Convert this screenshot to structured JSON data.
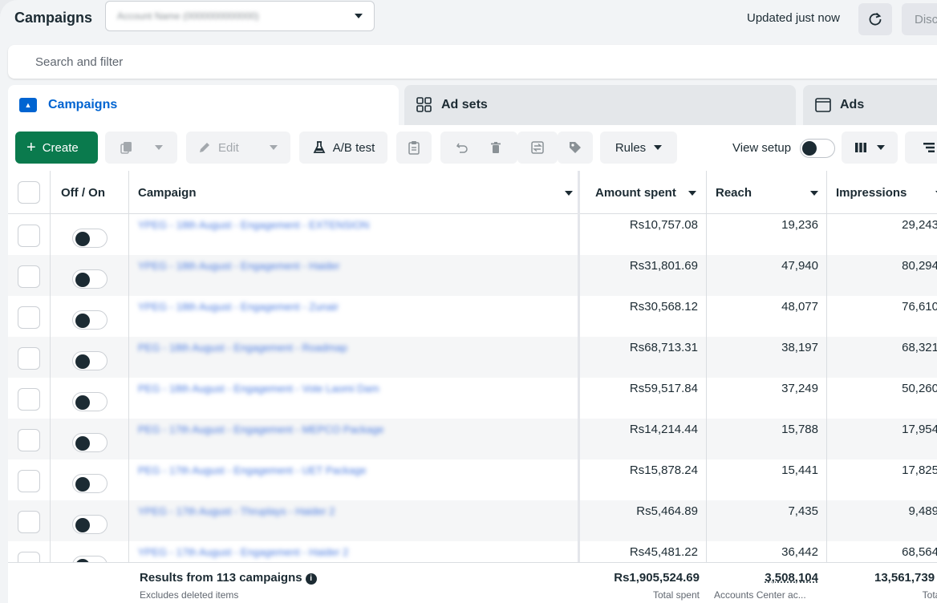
{
  "header": {
    "title": "Campaigns",
    "updated_text": "Updated just now",
    "discard_label": "Discard"
  },
  "search": {
    "placeholder": "Search and filter"
  },
  "tabs": [
    {
      "label": "Campaigns"
    },
    {
      "label": "Ad sets"
    },
    {
      "label": "Ads"
    }
  ],
  "toolbar": {
    "create_label": "Create",
    "edit_label": "Edit",
    "ab_test_label": "A/B test",
    "rules_label": "Rules",
    "view_setup_label": "View setup"
  },
  "table": {
    "columns": {
      "off_on": "Off / On",
      "campaign": "Campaign",
      "amount_spent": "Amount spent",
      "reach": "Reach",
      "impressions": "Impressions"
    },
    "rows": [
      {
        "amount": "Rs10,757.08",
        "reach": "19,236",
        "impressions": "29,243"
      },
      {
        "amount": "Rs31,801.69",
        "reach": "47,940",
        "impressions": "80,294"
      },
      {
        "amount": "Rs30,568.12",
        "reach": "48,077",
        "impressions": "76,610"
      },
      {
        "amount": "Rs68,713.31",
        "reach": "38,197",
        "impressions": "68,321"
      },
      {
        "amount": "Rs59,517.84",
        "reach": "37,249",
        "impressions": "50,260"
      },
      {
        "amount": "Rs14,214.44",
        "reach": "15,788",
        "impressions": "17,954"
      },
      {
        "amount": "Rs15,878.24",
        "reach": "15,441",
        "impressions": "17,825"
      },
      {
        "amount": "Rs5,464.89",
        "reach": "7,435",
        "impressions": "9,489"
      },
      {
        "amount": "Rs45,481.22",
        "reach": "36,442",
        "impressions": "68,564"
      }
    ],
    "footer": {
      "title": "Results from 113 campaigns",
      "subtitle": "Excludes deleted items",
      "amount_total": "Rs1,905,524.69",
      "amount_caption": "Total spent",
      "reach_total": "3,508,104",
      "reach_caption": "Accounts Center ac...",
      "impressions_total": "13,561,739",
      "impressions_caption": "Total"
    }
  },
  "colors": {
    "accent": "#0064d1",
    "create_button": "#0a7a4d"
  }
}
